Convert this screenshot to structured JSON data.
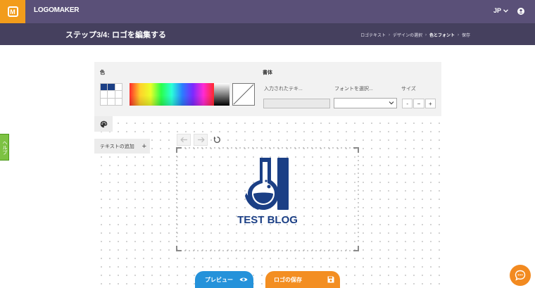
{
  "header": {
    "brand": "LOGOMAKER",
    "logo_letter": "M",
    "language": "JP",
    "accent_color": "#f29c1b",
    "bar_color": "#5a5078"
  },
  "subheader": {
    "step_title": "ステップ3/4: ロゴを編集する",
    "breadcrumbs": [
      {
        "label": "ロゴテキスト"
      },
      {
        "label": "デザインの選択"
      },
      {
        "label": "色とフォント"
      },
      {
        "label": "保存"
      }
    ],
    "separator": "›"
  },
  "help_tab": {
    "label": "ヘルプ"
  },
  "editor": {
    "color_label": "色",
    "font_label": "書体",
    "text_field_label": "入力されたテキ...",
    "font_select_label": "フォントを選択...",
    "size_label": "サイズ",
    "size_controls": [
      "-",
      "−",
      "+"
    ],
    "add_text_label": "テキストの追加",
    "add_text_plus": "+",
    "swatch_colors": [
      "#1b3f85",
      "#1b3f85",
      "#ffffff",
      "#ffffff",
      "#ffffff",
      "#ffffff",
      "#ffffff",
      "#ffffff",
      "#ffffff"
    ]
  },
  "logo": {
    "text": "TEST BLOG",
    "color": "#1b3f85"
  },
  "buttons": {
    "preview": "プレビュー",
    "save": "ロゴの保存"
  },
  "icons": [
    "palette-icon",
    "undo-icon",
    "redo-icon",
    "reset-icon",
    "eye-icon",
    "floppy-icon",
    "chat-icon",
    "user-icon",
    "chevron-down-icon"
  ]
}
